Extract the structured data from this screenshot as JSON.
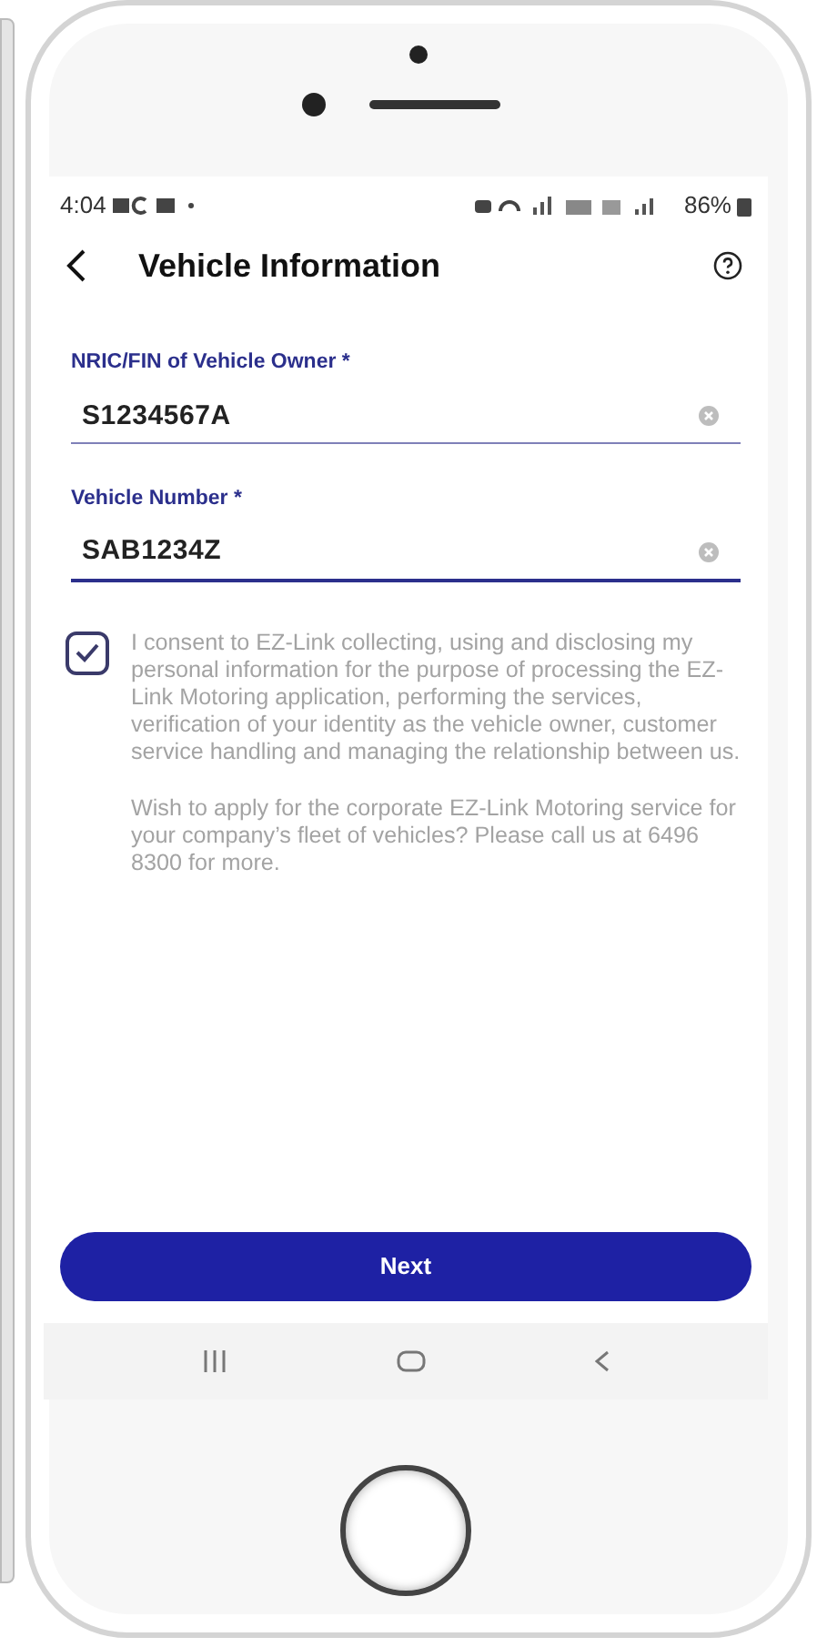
{
  "status_bar": {
    "time": "4:04",
    "battery": "86%"
  },
  "header": {
    "title": "Vehicle Information"
  },
  "fields": [
    {
      "label": "NRIC/FIN of Vehicle Owner *",
      "value": "S1234567A",
      "focused": false
    },
    {
      "label": "Vehicle Number *",
      "value": "SAB1234Z",
      "focused": true
    }
  ],
  "consent": {
    "checked": true,
    "text": "I consent to EZ-Link collecting, using and disclosing my personal information for the purpose of processing the EZ-Link Motoring application, performing the services, verification of your identity as the vehicle owner, customer service handling and managing the relationship between us."
  },
  "note": "Wish to apply for the corporate EZ-Link Motoring service for your company’s fleet of vehicles? Please call us at 6496 8300 for more.",
  "button": {
    "label": "Next"
  }
}
